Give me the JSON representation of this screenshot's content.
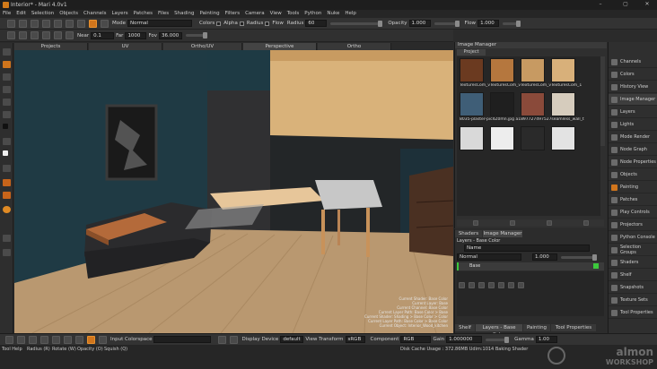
{
  "window": {
    "title": "Interior* - Mari 4.0v1",
    "controls": [
      "–",
      "▢",
      "✕"
    ]
  },
  "menu": [
    "File",
    "Edit",
    "Selection",
    "Objects",
    "Channels",
    "Layers",
    "Patches",
    "Files",
    "Shading",
    "Painting",
    "Filters",
    "Camera",
    "View",
    "Tools",
    "Python",
    "Nuke",
    "Help"
  ],
  "toolbar1": {
    "mode_label": "Mode",
    "mode_value": "Normal",
    "colors_label": "Colors",
    "alpha_label": "Alpha",
    "radius_label": "Radius",
    "flow_label": "Flow",
    "radius2_label": "Radius",
    "radius_value": "60",
    "opacity_label": "Opacity",
    "opacity_value": "1.000",
    "flow2_label": "Flow",
    "flow_value": "1.000"
  },
  "toolbar2": {
    "near_label": "Near",
    "near_value": "0.1",
    "far_label": "Far",
    "far_value": "1000",
    "fov_label": "Fov",
    "fov_value": "36.000"
  },
  "view_tabs": [
    "Projects",
    "UV",
    "Ortho/UV",
    "Perspective",
    "Ortho"
  ],
  "viewport": {
    "overlay_lines": [
      "Current Shader: Base Color",
      "Current Layer: Base",
      "Current Channel: Base Color",
      "Current Layer Path: Base Color > Base",
      "Current Shader: Shading > Base Color > Color",
      "Current Layer Path: Base Color > Base Color",
      "Current Object: Interior_Wood_kitchen"
    ]
  },
  "image_manager": {
    "title": "Image Manager",
    "tab": "Project",
    "thumbs": [
      {
        "label": "TexturesCom_v…",
        "color": "#6b3a20"
      },
      {
        "label": "TexturesCom_v…",
        "color": "#b5773e"
      },
      {
        "label": "TexturesCom_v…",
        "color": "#c79a62"
      },
      {
        "label": "TexturesCom_v…",
        "color": "#d8b07a"
      },
      {
        "label": "8035-plaster-pic…",
        "color": "#3f5e77"
      },
      {
        "label": "",
        "color": "#222"
      },
      {
        "label": "a189772749752…",
        "color": "#8a4a3a"
      },
      {
        "label": "seamless_wall…",
        "color": "#d6ccbd"
      },
      {
        "label": "",
        "color": "#d9d9d9"
      },
      {
        "label": "",
        "color": "#ededed"
      },
      {
        "label": "",
        "color": "#2a2a2a"
      },
      {
        "label": "",
        "color": "#e3e3e3"
      }
    ],
    "filename_row": "TexturesCom_vTexturesCom_vTexturesCom_vTexturesCom_1",
    "filename_row2": "8035-plaster-pic4Z0mn.jpg      a1897727497527seamless_wall_t"
  },
  "layers_panel": {
    "tabs": [
      "Shaders",
      "Image Manager"
    ],
    "title": "Layers - Base Color",
    "search_placeholder": "Name",
    "blend_mode": "Normal",
    "opacity": "1.000",
    "layer_name": "Base",
    "bottom_tabs": [
      "Shelf",
      "Layers - Base Color",
      "Painting",
      "Tool Properties"
    ]
  },
  "right_shelf": {
    "items": [
      "Channels",
      "Colors",
      "History View",
      "Image Manager",
      "Layers",
      "Lights",
      "Mode Render",
      "Node Graph",
      "Node Properties",
      "Objects",
      "Painting",
      "Patches",
      "Play Controls",
      "Projectors",
      "Python Console",
      "Selection Groups",
      "Shaders",
      "Shelf",
      "Snapshots",
      "Texture Sets",
      "Tool Properties"
    ],
    "active": "Image Manager"
  },
  "bottom_bar": {
    "input_colorspace_label": "Input Colorspace",
    "input_colorspace_value": "",
    "display_device_label": "Display Device",
    "display_device_value": "default",
    "view_transform_label": "View Transform",
    "view_transform_value": "sRGB",
    "component_label": "Component",
    "component_value": "RGB",
    "gain_label": "Gain",
    "gain_value": "1.000000",
    "gamma_label": "Gamma",
    "gamma_value": "1.00"
  },
  "status": {
    "tool_help_label": "Tool Help",
    "hints": [
      "Radius (R)",
      "Rotate (W)",
      "Opacity (O)",
      "Squish (Q)"
    ],
    "cache": "Disk Cache Usage : 372.86MB  Udim:1014  Baking Shader"
  },
  "watermark": {
    "line1": "almon",
    "line2": "WORKSHOP"
  },
  "colors": {
    "accent": "#d0751c",
    "wall": "#1f3c46",
    "floor": "#b99870"
  }
}
